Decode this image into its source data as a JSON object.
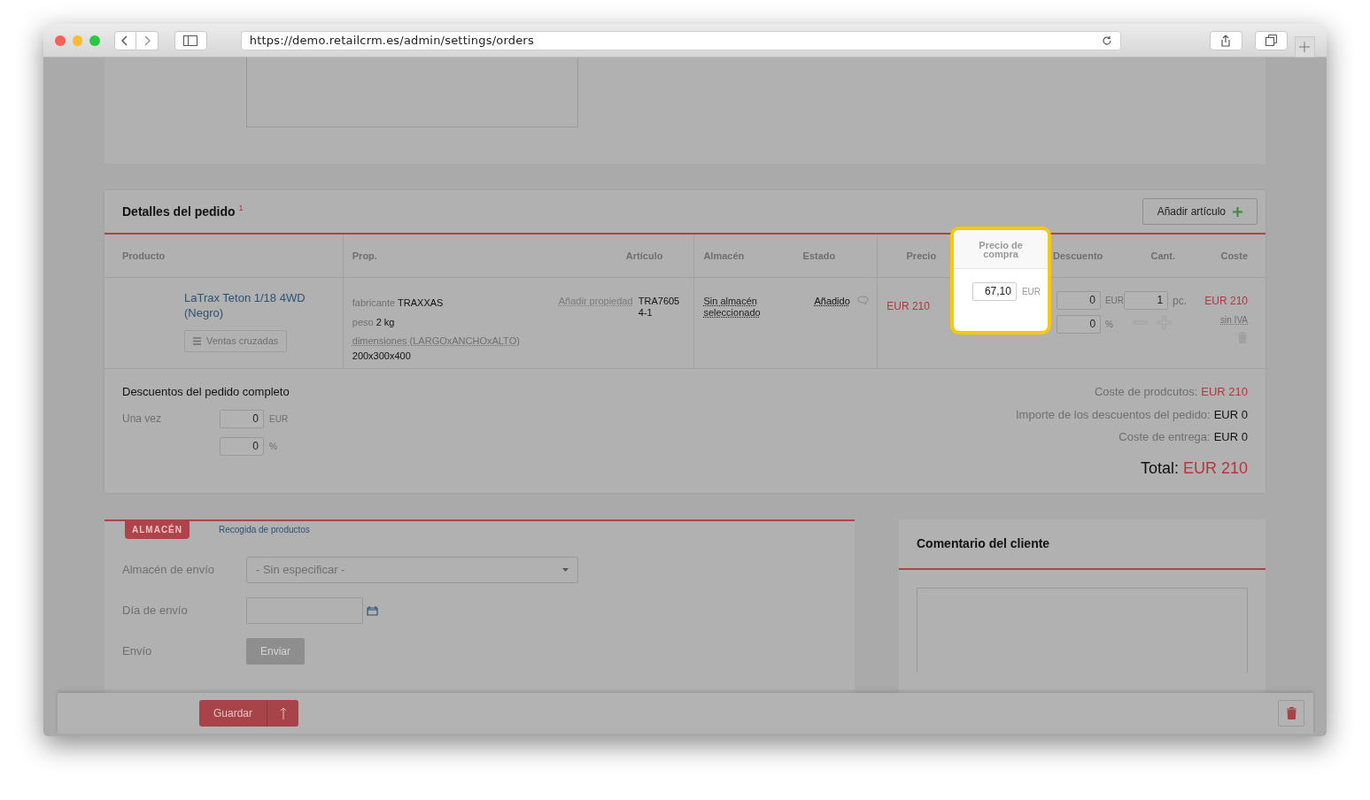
{
  "browser": {
    "url": "https://demo.retailcrm.es/admin/settings/orders"
  },
  "order_details": {
    "title": "Detalles del pedido",
    "footnote": "1",
    "add_button": "Añadir artículo",
    "columns": [
      {
        "label": "Producto",
        "highlighted": false
      },
      {
        "label": "Prop.",
        "highlighted": false
      },
      {
        "label": "Artículo",
        "highlighted": false
      },
      {
        "label": "Almacén",
        "highlighted": false
      },
      {
        "label": "Estado",
        "highlighted": false
      },
      {
        "label": "Precio",
        "highlighted": false
      },
      {
        "label": "Precio de compra",
        "highlighted": true
      },
      {
        "label": "Descuento",
        "highlighted": false
      },
      {
        "label": "Cant.",
        "highlighted": false
      },
      {
        "label": "Coste",
        "highlighted": false
      }
    ],
    "item": {
      "name": "LaTrax Teton 1/18 4WD (Negro)",
      "cross_sell_button": "Ventas cruzadas",
      "props": [
        {
          "key": "fabricante",
          "value": "TRAXXAS",
          "kind": "inline"
        },
        {
          "key": "peso",
          "value": "2 kg",
          "kind": "inline"
        },
        {
          "key": "dimensiones (LARGOxANCHOxALTO)",
          "value": "200x300x400",
          "kind": "block"
        }
      ],
      "add_property": "Añadir propiedad",
      "article": "TRA7605 4-1",
      "warehouse": "Sin almacén seleccionado",
      "status": "Añadido",
      "price": "EUR 210",
      "purchase_price": "67,10",
      "purchase_currency": "EUR",
      "discount_amount": "0",
      "discount_currency": "EUR",
      "discount_percent": "0",
      "percent_sign": "%",
      "quantity": "1",
      "unit": "pc.",
      "cost": "EUR 210",
      "tax_note": "sin IVA"
    },
    "order_discounts": {
      "title": "Descuentos del pedido completo",
      "label": "Una vez",
      "amount": "0",
      "currency": "EUR",
      "percent": "0",
      "percent_sign": "%"
    },
    "totals": [
      {
        "label": "Coste de prodcutos:",
        "value": "EUR 210",
        "kind": "accent"
      },
      {
        "label": "Importe de los descuentos del pedido:",
        "value": "EUR 0",
        "kind": "plain"
      },
      {
        "label": "Coste de entrega:",
        "value": "EUR 0",
        "kind": "plain"
      }
    ],
    "total": {
      "label": "Total:",
      "value": "EUR 210"
    }
  },
  "shipping": {
    "tabs": [
      {
        "label": "ALMACÉN",
        "selected": true
      },
      {
        "label": "Recogida de productos",
        "selected": false
      }
    ],
    "fields": [
      {
        "label": "Almacén de envío",
        "kind": "select",
        "value": "- Sin especificar -"
      },
      {
        "label": "Día de envío",
        "kind": "date"
      },
      {
        "label": "Envío",
        "kind": "button",
        "button": "Enviar",
        "disabled": true
      }
    ]
  },
  "comment": {
    "title": "Comentario del cliente"
  },
  "footer": {
    "save_button": "Guardar"
  }
}
